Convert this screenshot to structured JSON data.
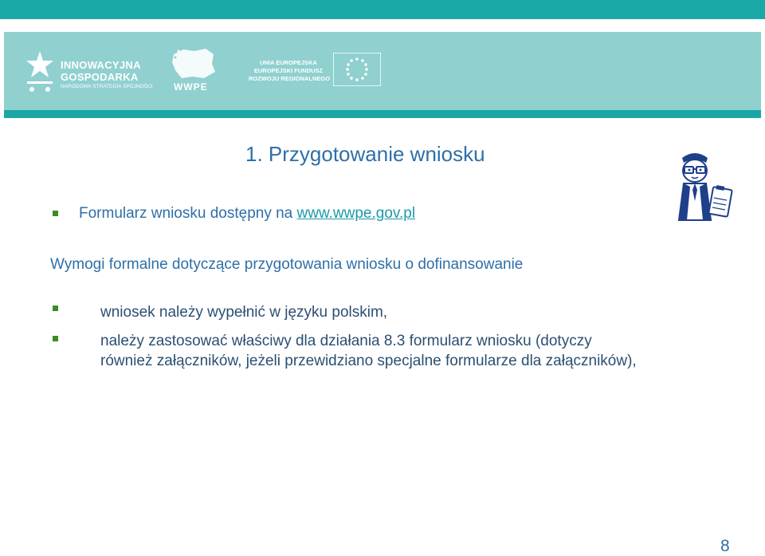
{
  "banner": {
    "logo_innowacyjna": {
      "line1": "INNOWACYJNA",
      "line2": "GOSPODARKA",
      "line3": "NARODOWA STRATEGIA SPÓJNOŚCI"
    },
    "logo_wwpe": {
      "text": "WWPE"
    },
    "logo_eu": {
      "line1": "UNIA EUROPEJSKA",
      "line2": "EUROPEJSKI FUNDUSZ",
      "line3": "ROZWOJU REGIONALNEGO"
    },
    "colors": {
      "top_bar": "#1aa7a7",
      "banner_bg": "#90d0cf",
      "banner_line": "#19a6a5"
    }
  },
  "slide": {
    "title": "1. Przygotowanie wniosku",
    "form_line_prefix": "Formularz wniosku dostępny na ",
    "form_link": "www.wwpe.gov.pl",
    "requirements_heading": "Wymogi formalne dotyczące przygotowania wniosku o dofinansowanie",
    "items": [
      "wniosek należy wypełnić w języku polskim,",
      "należy zastosować właściwy dla działania 8.3 formularz wniosku (dotyczy",
      "również załączników, jeżeli przewidziano specjalne formularze dla załączników),"
    ],
    "page_number": "8",
    "colors": {
      "title": "#2e6fa8",
      "bullet": "#3a8c28",
      "link": "#1a9aa6"
    }
  }
}
